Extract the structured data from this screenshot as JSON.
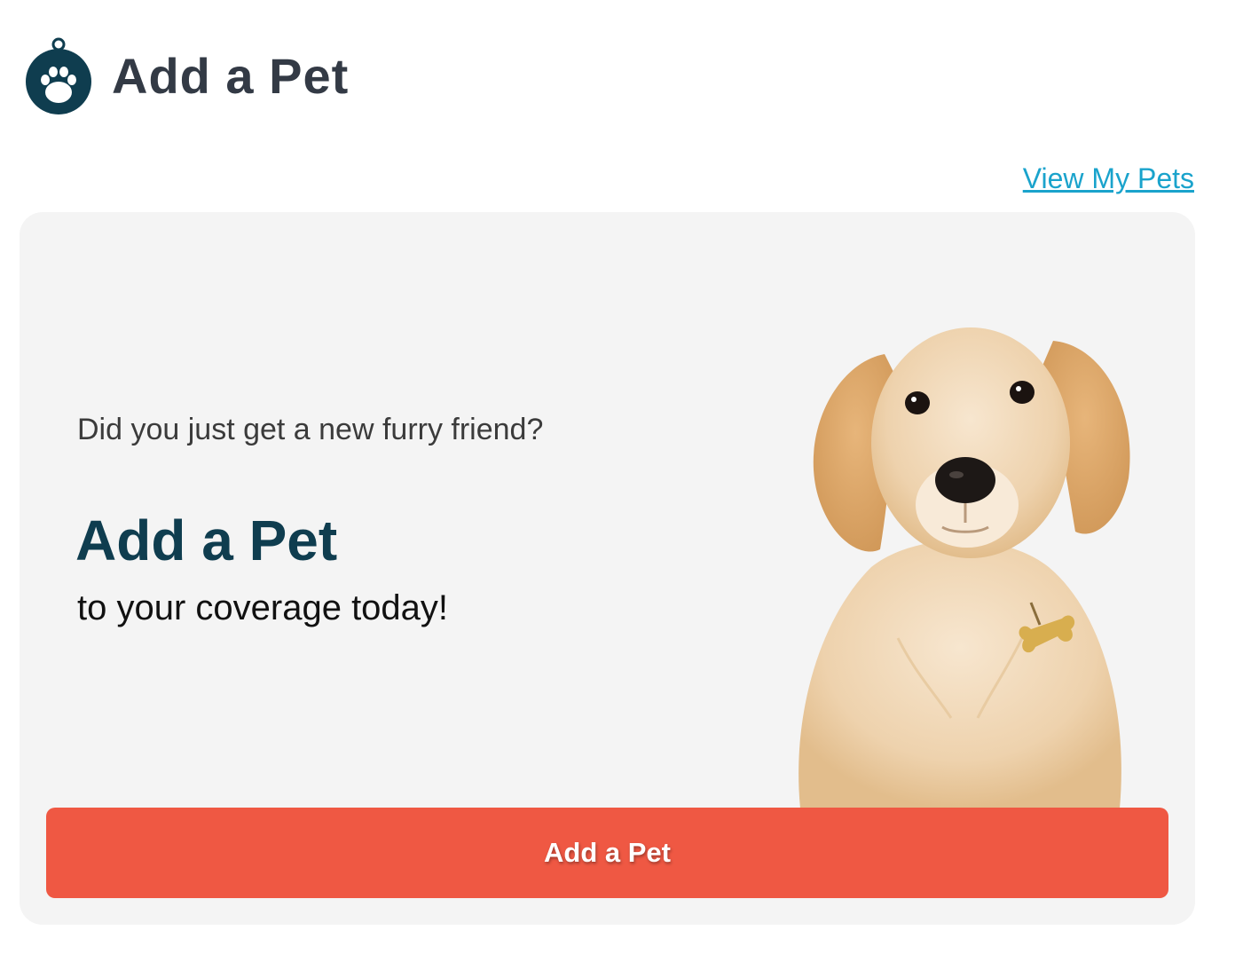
{
  "header": {
    "title": "Add a Pet",
    "icon": "paw-tag-icon"
  },
  "nav": {
    "view_my_pets": "View My Pets"
  },
  "promo": {
    "prompt": "Did you just get a new furry friend?",
    "title": "Add a Pet",
    "subtitle": "to your coverage today!",
    "image": "golden-retriever-puppy",
    "button_label": "Add a Pet"
  },
  "colors": {
    "title_text": "#333a45",
    "icon_navy": "#0f3d4f",
    "link": "#1aa3cc",
    "card_bg": "#f4f4f4",
    "button_bg": "#ef5843"
  }
}
